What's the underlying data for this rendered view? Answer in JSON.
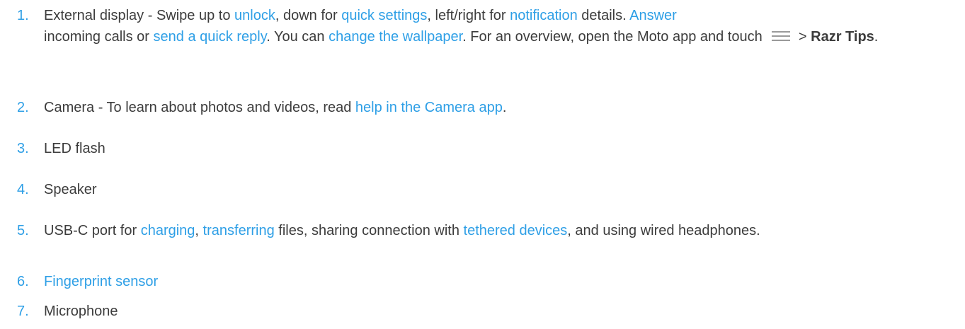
{
  "items": [
    {
      "num": "1.",
      "p1": "External display - Swipe up to ",
      "l1": "unlock",
      "p2": ", down for ",
      "l2": "quick settings",
      "p3": ", left/right for ",
      "l3": "notification",
      "p4": " details. ",
      "l4": "Answer",
      "p5": " incoming calls or ",
      "l5": "send a quick reply",
      "p6": ". You can ",
      "l6": "change the wallpaper",
      "p7": ". For an overview, open the Moto app and touch ",
      "p8": " > ",
      "bold": "Razr Tips",
      "p9": ".",
      "icon": "menu-icon"
    },
    {
      "num": "2.",
      "p1": "Camera - To learn about photos and videos, read ",
      "l1": "help in the Camera app",
      "p2": "."
    },
    {
      "num": "3.",
      "p1": "LED flash"
    },
    {
      "num": "4.",
      "p1": "Speaker"
    },
    {
      "num": "5.",
      "p1": "USB-C port for ",
      "l1": "charging",
      "p2": ", ",
      "l2": "transferring",
      "p3": " files, sharing connection with ",
      "l3": "tethered devices",
      "p4": ", and using wired headphones."
    },
    {
      "num": "6.",
      "l1": "Fingerprint sensor"
    },
    {
      "num": "7.",
      "p1": "Microphone"
    }
  ],
  "colors": {
    "link": "#2e9fe6",
    "text": "#3c3c3c",
    "icon": "#9a9a9a"
  }
}
